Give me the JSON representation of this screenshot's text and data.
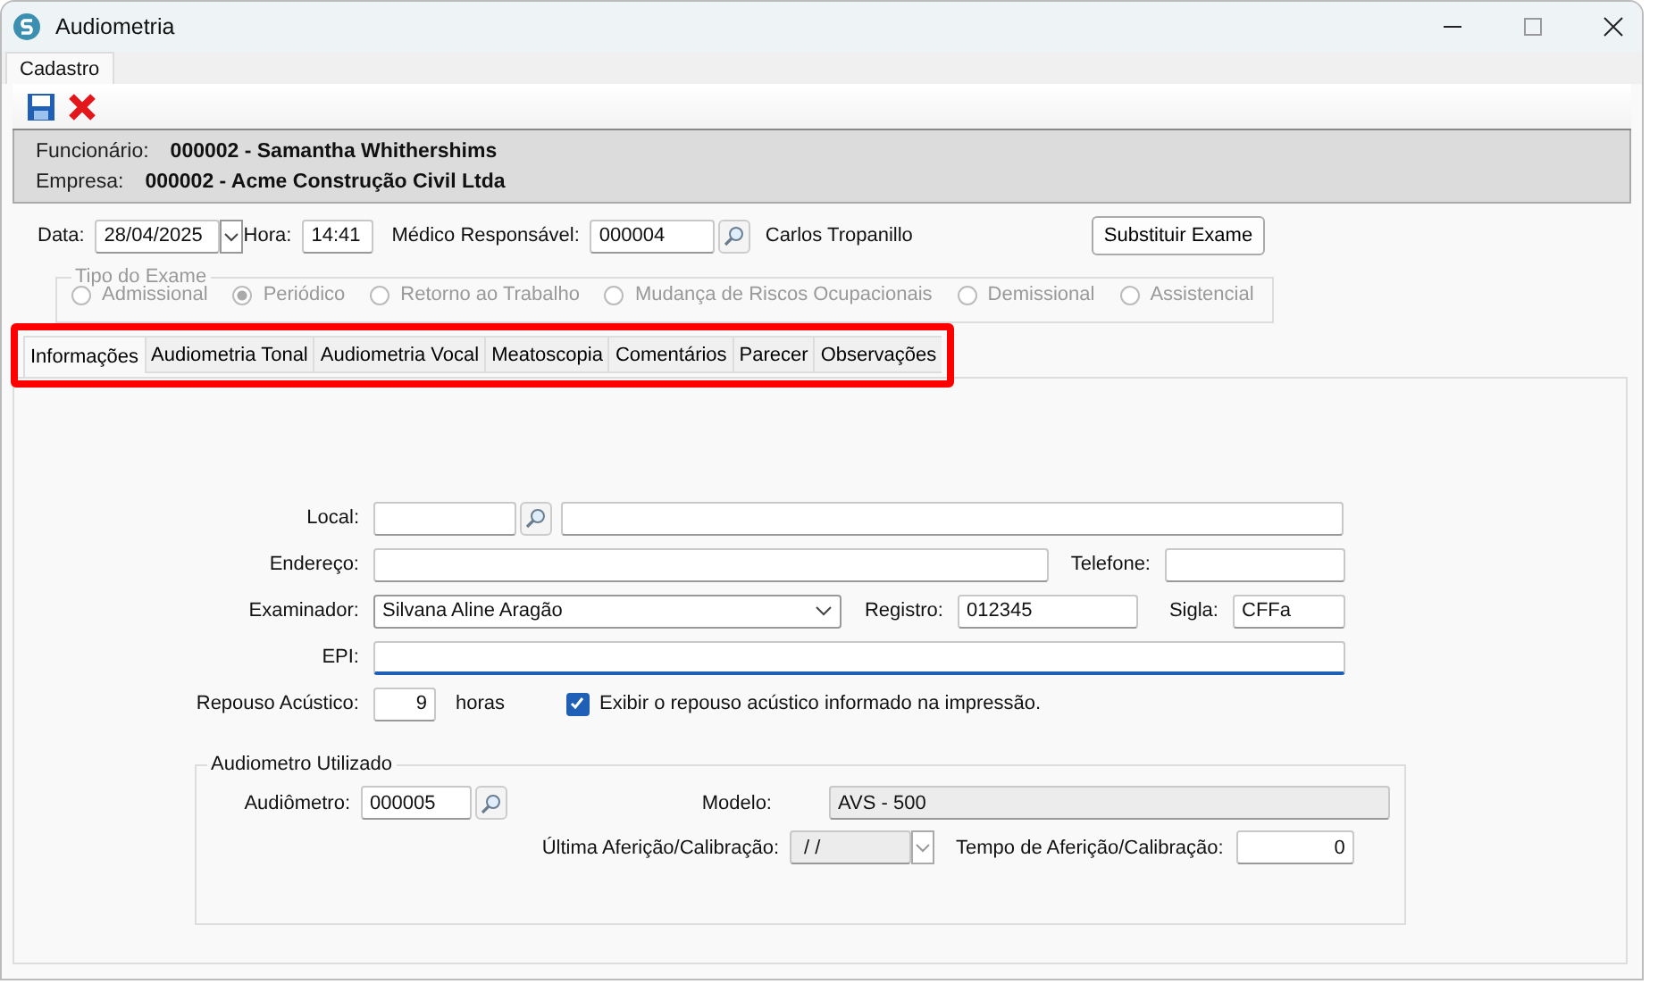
{
  "window": {
    "title": "Audiometria"
  },
  "main_tabs": [
    {
      "label": "Cadastro",
      "selected": true
    }
  ],
  "header": {
    "employee": {
      "label": "Funcionário:",
      "value": "000002 - Samantha Whithershims"
    },
    "company": {
      "label": "Empresa:",
      "value": "000002 - Acme Construção Civil Ltda"
    }
  },
  "exam": {
    "date_label": "Data:",
    "date": "28/04/2025",
    "time_label": "Hora:",
    "time": "14:41",
    "doctor_label": "Médico Responsável:",
    "doctor_code": "000004",
    "doctor_name": "Carlos Tropanillo",
    "replace_button": "Substituir Exame"
  },
  "exam_type": {
    "legend": "Tipo do Exame",
    "disabled": true,
    "options": [
      {
        "label": "Admissional",
        "selected": false
      },
      {
        "label": "Periódico",
        "selected": true
      },
      {
        "label": "Retorno ao Trabalho",
        "selected": false
      },
      {
        "label": "Mudança de Riscos Ocupacionais",
        "selected": false
      },
      {
        "label": "Demissional",
        "selected": false
      },
      {
        "label": "Assistencial",
        "selected": false
      }
    ]
  },
  "section_tabs": [
    {
      "label": "Informações",
      "selected": true
    },
    {
      "label": "Audiometria Tonal",
      "selected": false
    },
    {
      "label": "Audiometria Vocal",
      "selected": false
    },
    {
      "label": "Meatoscopia",
      "selected": false
    },
    {
      "label": "Comentários",
      "selected": false
    },
    {
      "label": "Parecer",
      "selected": false
    },
    {
      "label": "Observações",
      "selected": false
    }
  ],
  "info": {
    "local_label": "Local:",
    "address_label": "Endereço:",
    "phone_label": "Telefone:",
    "examiner_label": "Examinador:",
    "examiner": "Silvana Aline Aragão",
    "registry_label": "Registro:",
    "registry": "012345",
    "acronym_label": "Sigla:",
    "acronym": "CFFa",
    "epi_label": "EPI:",
    "epi_focused": true,
    "rest_label": "Repouso Acústico:",
    "rest": "9",
    "rest_unit": "horas",
    "print_rest": {
      "label": "Exibir o repouso acústico informado na impressão.",
      "checked": true
    }
  },
  "audiometer": {
    "legend": "Audiometro Utilizado",
    "device_label": "Audiômetro:",
    "device": "000005",
    "model_label": "Modelo:",
    "model": "AVS - 500",
    "calibration_label": "Última Aferição/Calibração:",
    "calibration": " / /",
    "interval_label": "Tempo de Aferição/Calibração:",
    "interval": "0"
  }
}
